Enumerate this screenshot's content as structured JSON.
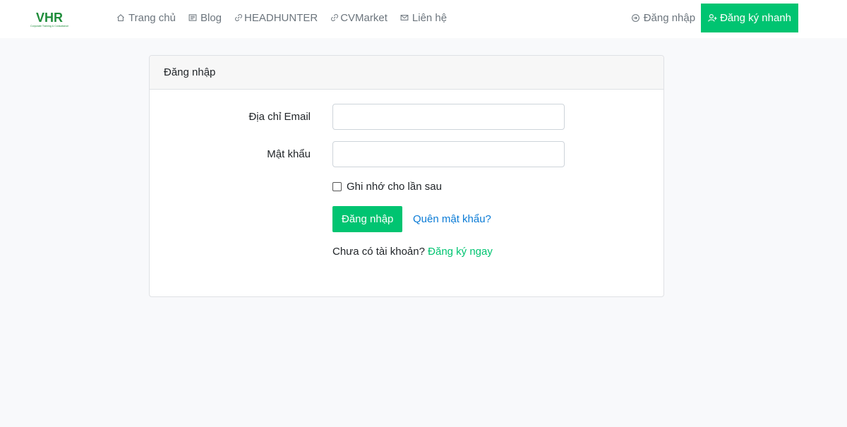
{
  "brand": {
    "logo_text": "VHR",
    "logo_tagline": "Corporate Training & Consultance",
    "accent_color": "#00c471",
    "link_color": "#0a7bd6"
  },
  "nav": {
    "items": [
      {
        "label": "Trang chủ",
        "icon": "home-icon"
      },
      {
        "label": "Blog",
        "icon": "newspaper-icon"
      },
      {
        "label": "HEADHUNTER",
        "icon": "link-icon"
      },
      {
        "label": "CVMarket",
        "icon": "link-icon"
      },
      {
        "label": "Liên hệ",
        "icon": "envelope-icon"
      }
    ],
    "login_label": "Đăng nhập",
    "register_label": "Đăng ký nhanh"
  },
  "card": {
    "title": "Đăng nhập",
    "email_label": "Địa chỉ Email",
    "email_value": "",
    "password_label": "Mật khẩu",
    "password_value": "",
    "remember_label": "Ghi nhớ cho lần sau",
    "remember_checked": false,
    "submit_label": "Đăng nhập",
    "forgot_label": "Quên mật khẩu?",
    "no_account_text": "Chưa có tài khoản?",
    "signup_label": "Đăng ký ngay"
  }
}
